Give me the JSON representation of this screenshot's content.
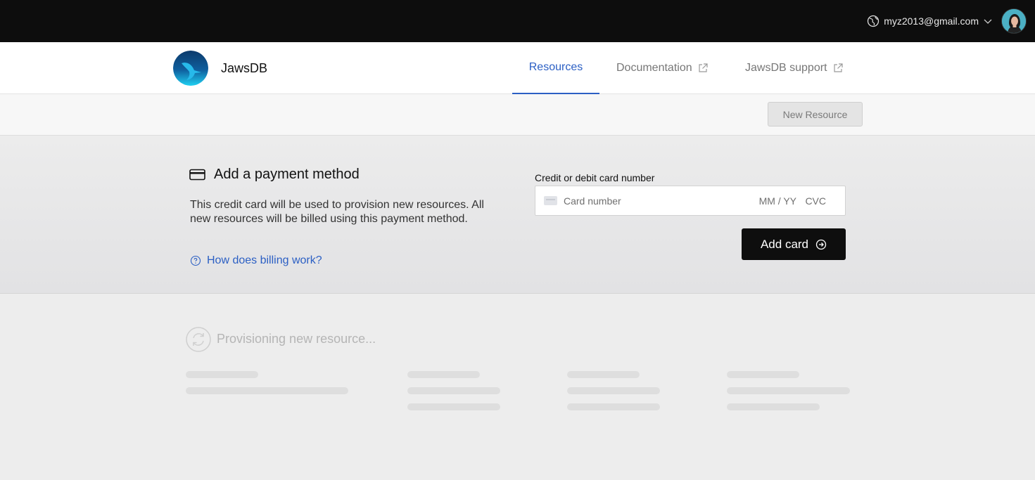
{
  "account": {
    "email": "myz2013@gmail.com"
  },
  "header": {
    "app_name": "JawsDB",
    "nav": [
      {
        "label": "Resources",
        "active": true
      },
      {
        "label": "Documentation",
        "external": true
      },
      {
        "label": "JawsDB support",
        "external": true
      }
    ]
  },
  "actionbar": {
    "new_resource_label": "New Resource"
  },
  "payment": {
    "title": "Add a payment method",
    "description": "This credit card will be used to provision new resources. All new resources will be billed using this payment method.",
    "help_link": "How does billing work?",
    "card_label": "Credit or debit card number",
    "card_placeholder": "Card number",
    "expiry_placeholder": "MM / YY",
    "cvc_placeholder": "CVC",
    "add_card_label": "Add card"
  },
  "provisioning": {
    "text": "Provisioning new resource..."
  },
  "colors": {
    "accent": "#2b5fc4",
    "topbar": "#0d0d0d",
    "button_dark": "#0e0e0e"
  }
}
